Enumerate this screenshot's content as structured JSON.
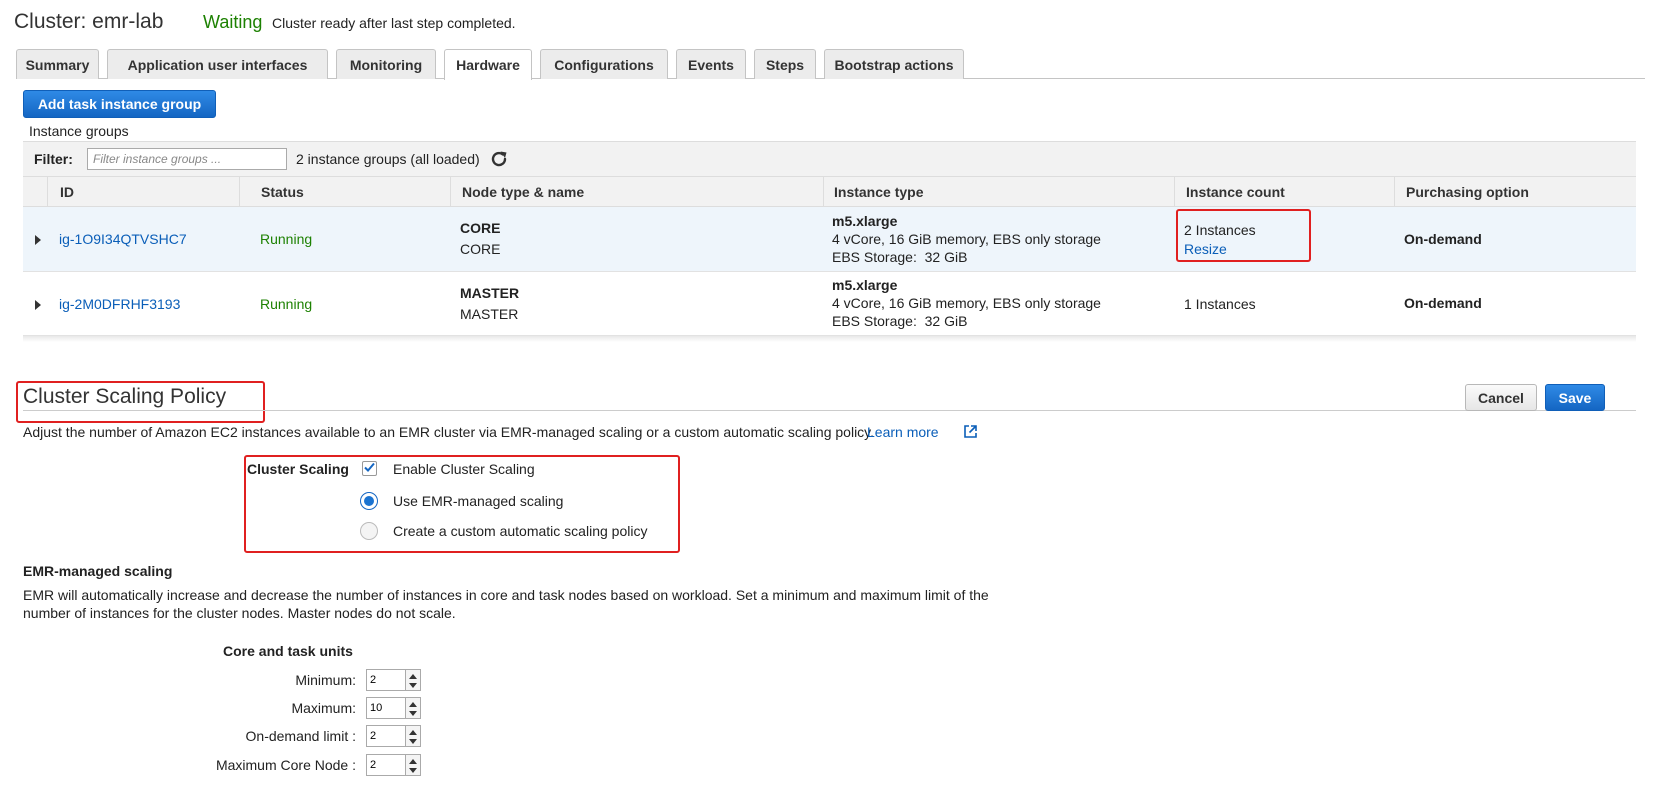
{
  "header": {
    "title": "Cluster: emr-lab",
    "state": "Waiting",
    "state_message": "Cluster ready after last step completed."
  },
  "tabs": [
    {
      "label": "Summary"
    },
    {
      "label": "Application user interfaces"
    },
    {
      "label": "Monitoring"
    },
    {
      "label": "Hardware",
      "active": true
    },
    {
      "label": "Configurations"
    },
    {
      "label": "Events"
    },
    {
      "label": "Steps"
    },
    {
      "label": "Bootstrap actions"
    }
  ],
  "hardware": {
    "add_button": "Add task instance group",
    "section_label": "Instance groups",
    "filter": {
      "label": "Filter:",
      "placeholder": "Filter instance groups ...",
      "count_text": "2 instance groups (all loaded)"
    },
    "columns": [
      "ID",
      "Status",
      "Node type & name",
      "Instance type",
      "Instance count",
      "Purchasing option"
    ],
    "rows": [
      {
        "id": "ig-1O9I34QTVSHC7",
        "status": "Running",
        "node_type": "CORE",
        "node_name": "CORE",
        "instance_type": "m5.xlarge",
        "spec": "4 vCore, 16 GiB memory, EBS only storage",
        "ebs": "EBS Storage:  32 GiB",
        "count": "2 Instances",
        "count_action": "Resize",
        "purchasing": "On-demand"
      },
      {
        "id": "ig-2M0DFRHF3193",
        "status": "Running",
        "node_type": "MASTER",
        "node_name": "MASTER",
        "instance_type": "m5.xlarge",
        "spec": "4 vCore, 16 GiB memory, EBS only storage",
        "ebs": "EBS Storage:  32 GiB",
        "count": "1 Instances",
        "purchasing": "On-demand"
      }
    ]
  },
  "policy": {
    "title": "Cluster Scaling Policy",
    "cancel_label": "Cancel",
    "save_label": "Save",
    "description": "Adjust the number of Amazon EC2 instances available to an EMR cluster via EMR-managed scaling or a custom automatic scaling policy.",
    "learn_more": "Learn more",
    "scaling_label": "Cluster Scaling",
    "enable_label": "Enable Cluster Scaling",
    "enabled": true,
    "managed_label": "Use EMR-managed scaling",
    "custom_label": "Create a custom automatic scaling policy",
    "selected_mode": "managed"
  },
  "managed": {
    "title": "EMR-managed scaling",
    "desc_line1": "EMR will automatically increase and decrease the number of instances in core and task nodes based on workload. Set a minimum and maximum limit of the",
    "desc_line2": "number of instances for the cluster nodes. Master nodes do not scale.",
    "units_title": "Core and task units",
    "fields": [
      {
        "label": "Minimum:",
        "value": "2"
      },
      {
        "label": "Maximum:",
        "value": "10"
      },
      {
        "label": "On-demand limit :",
        "value": "2"
      },
      {
        "label": "Maximum Core Node :",
        "value": "2"
      }
    ]
  },
  "colors": {
    "accent": "#1466c3",
    "link": "#0a5eb8",
    "running": "#1d8102",
    "highlight": "#e02020"
  }
}
